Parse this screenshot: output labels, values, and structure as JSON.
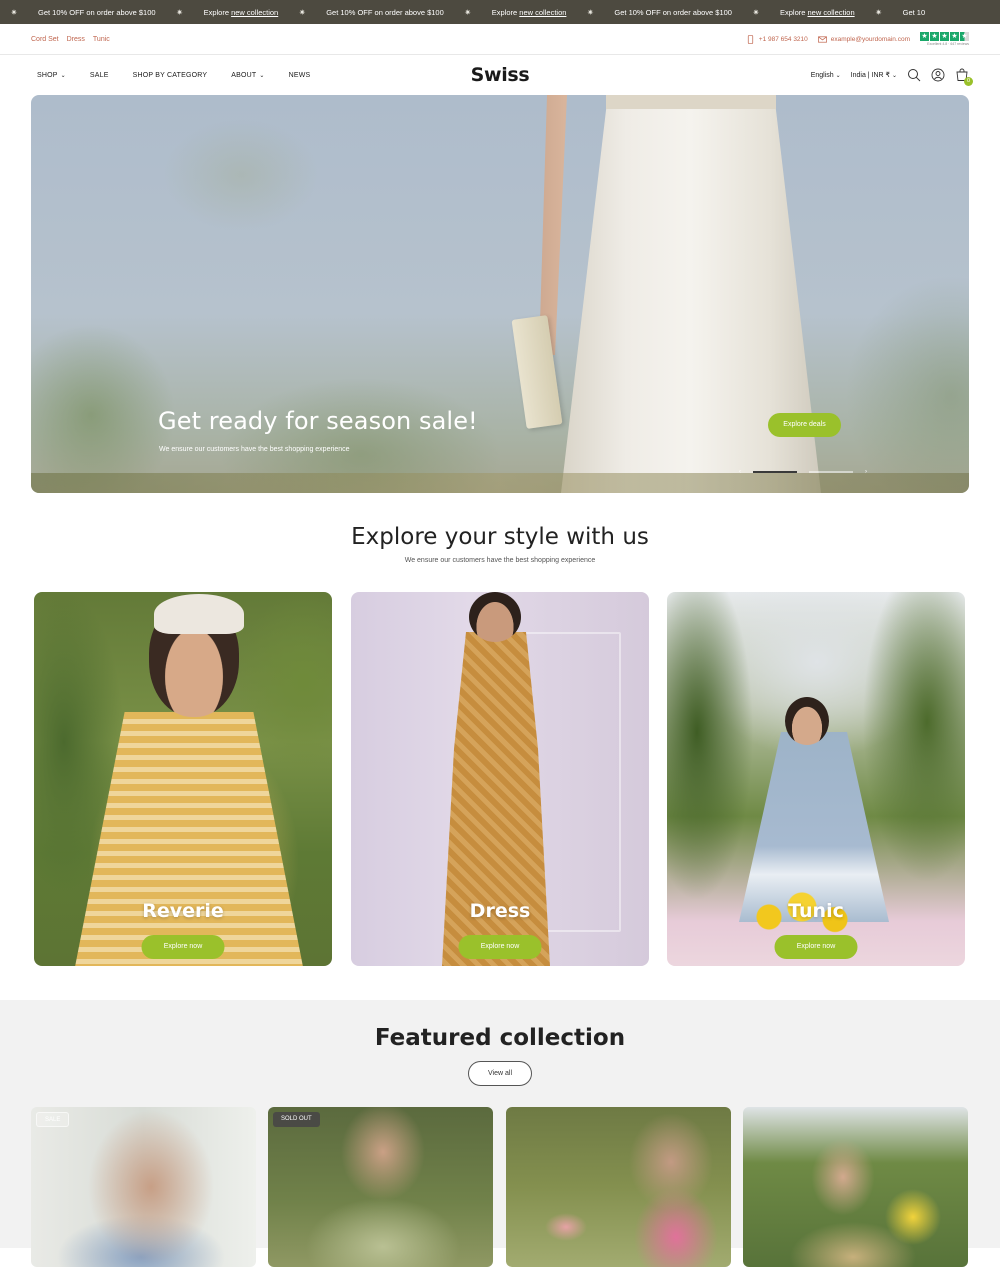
{
  "announcement": {
    "items": [
      {
        "pre": "Get 10% OFF on order above $100",
        "link": ""
      },
      {
        "pre": "Explore ",
        "link": "new collection"
      },
      {
        "pre": "Get 10% OFF on order above $100",
        "link": ""
      },
      {
        "pre": "Explore ",
        "link": "new collection"
      },
      {
        "pre": "Get 10% OFF on order above $100",
        "link": ""
      },
      {
        "pre": "Explore ",
        "link": "new collection"
      },
      {
        "pre": "Get 10",
        "link": ""
      }
    ]
  },
  "utility": {
    "links": [
      "Cord Set",
      "Dress",
      "Tunic"
    ],
    "phone": "+1 987 654 3210",
    "email": "example@yourdomain.com",
    "trust_caption": "Excellent 4.8 · 647 reviews"
  },
  "nav": {
    "menu": [
      {
        "label": "SHOP",
        "dropdown": true
      },
      {
        "label": "SALE",
        "dropdown": false
      },
      {
        "label": "SHOP BY CATEGORY",
        "dropdown": false
      },
      {
        "label": "ABOUT",
        "dropdown": true
      },
      {
        "label": "NEWS",
        "dropdown": false
      }
    ],
    "logo": "Swiss",
    "language": "English",
    "currency": "India | INR ₹",
    "cart_count": "0"
  },
  "hero": {
    "title": "Get ready for season sale!",
    "subtitle": "We ensure our customers have the best shopping experience",
    "cta": "Explore deals",
    "active_slide": 1,
    "slide_count": 2
  },
  "explore": {
    "title": "Explore your style with us",
    "subtitle": "We ensure our customers have the best shopping experience",
    "cards": [
      {
        "name": "Reverie",
        "cta": "Explore now"
      },
      {
        "name": "Dress",
        "cta": "Explore now"
      },
      {
        "name": "Tunic",
        "cta": "Explore now"
      }
    ]
  },
  "featured": {
    "title": "Featured collection",
    "view_all": "View all",
    "products": [
      {
        "badge": "SALE"
      },
      {
        "badge": "SOLD OUT"
      },
      {
        "badge": ""
      },
      {
        "badge": ""
      }
    ]
  },
  "colors": {
    "accent": "#9ac12b",
    "announcement_bg": "#4d4a40",
    "link": "#c0664f",
    "trust": "#1aa86a"
  },
  "icons": [
    "phone-icon",
    "mail-icon",
    "search-icon",
    "account-icon",
    "cart-icon",
    "chevron-down-icon"
  ]
}
